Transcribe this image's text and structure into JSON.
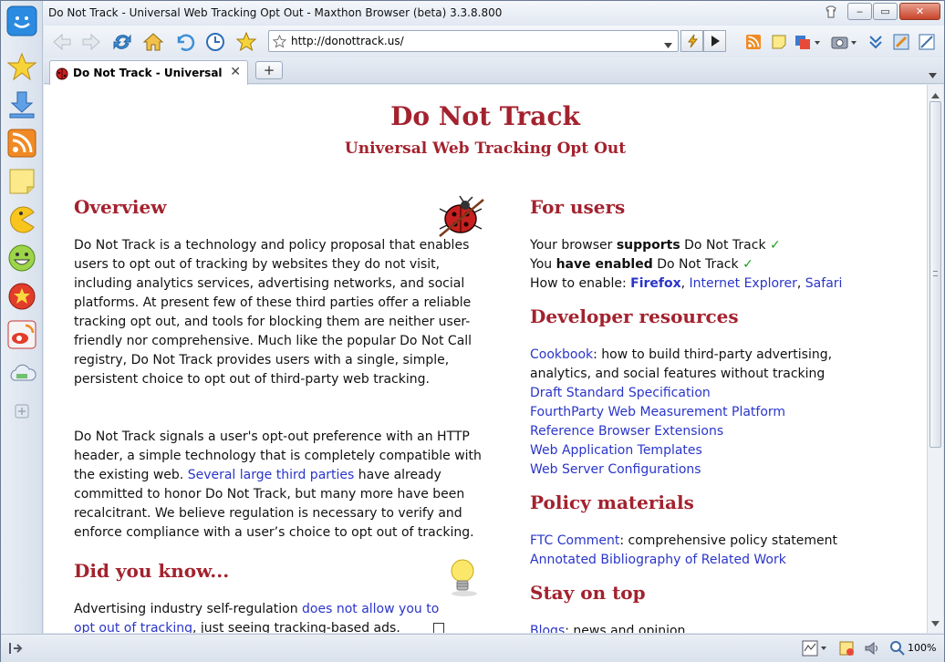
{
  "window": {
    "title": "Do Not Track - Universal Web Tracking Opt Out - Maxthon Browser (beta) 3.3.8.800",
    "controls": {
      "minimize": "‒",
      "maximize": "▭",
      "close": "✕"
    }
  },
  "toolbar": {
    "address": "http://donottrack.us/"
  },
  "tabs": [
    {
      "label": "Do Not Track - Universal W...",
      "close": "✕"
    }
  ],
  "newtab": "+",
  "statusbar": {
    "zoom": "100%"
  },
  "page": {
    "title": "Do Not Track",
    "subtitle": "Universal Web Tracking Opt Out",
    "overview": {
      "heading": "Overview",
      "para1": "Do Not Track is a technology and policy proposal that enables users to opt out of tracking by websites they do not visit, including analytics services, advertising networks, and social platforms. At present few of these third parties offer a reliable tracking opt out, and tools for blocking them are neither user-friendly nor comprehensive. Much like the popular Do Not Call registry, Do Not Track provides users with a single, simple, persistent choice to opt out of third-party web tracking.",
      "para2_pre": "Do Not Track signals a user's opt-out preference with an HTTP header, a simple technology that is completely compatible with the existing web. ",
      "para2_link": "Several large third parties",
      "para2_post": " have already committed to honor Do Not Track, but many more have been recalcitrant. We believe regulation is necessary to verify and enforce compliance with a user’s choice to opt out of tracking."
    },
    "didyouknow": {
      "heading": "Did you know...",
      "text_pre": "Advertising industry self-regulation ",
      "link": "does not allow you to opt out of tracking",
      "text_post": ", just seeing tracking-based ads."
    },
    "users": {
      "heading": "For users",
      "line1": {
        "a": "Your browser ",
        "b": "supports",
        "c": " Do Not Track ",
        "check": "✓"
      },
      "line2": {
        "a": "You ",
        "b": "have enabled",
        "c": " Do Not Track ",
        "check": "✓"
      },
      "line3": {
        "a": "How to enable: ",
        "firefox": "Firefox",
        "sep1": ", ",
        "ie": "Internet Explorer",
        "sep2": ", ",
        "safari": "Safari"
      }
    },
    "developer": {
      "heading": "Developer resources",
      "cookbook": "Cookbook",
      "cookbook_desc": ": how to build third-party advertising, analytics, and social features without tracking",
      "links": [
        "Draft Standard Specification",
        "FourthParty Web Measurement Platform",
        "Reference Browser Extensions",
        "Web Application Templates",
        "Web Server Configurations"
      ]
    },
    "policy": {
      "heading": "Policy materials",
      "ftc": "FTC Comment",
      "ftc_desc": ": comprehensive policy statement",
      "biblio": "Annotated Bibliography of Related Work"
    },
    "stay": {
      "heading": "Stay on top",
      "blogs": "Blogs",
      "blogs_desc": ": news and opinion"
    }
  }
}
